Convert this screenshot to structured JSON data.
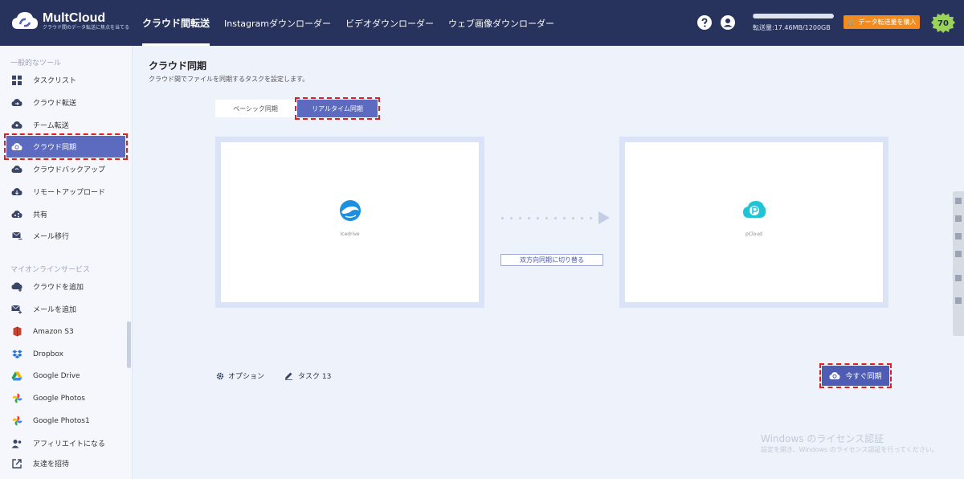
{
  "header": {
    "brand_name": "MultCloud",
    "brand_tagline": "クラウド間のデータ転送に焦点を当てる",
    "nav": [
      {
        "label": "クラウド間転送",
        "active": true
      },
      {
        "label": "Instagramダウンローダー",
        "active": false
      },
      {
        "label": "ビデオダウンローダー",
        "active": false
      },
      {
        "label": "ウェブ画像ダウンローダー",
        "active": false
      }
    ],
    "usage_text": "転送量:17.46MB/1200GB",
    "usage_fraction": 1.46e-05,
    "buy_label": "データ転送量を購入",
    "badge_value": "70",
    "accent": "#f28c1e",
    "bar_color": "#27335c"
  },
  "sidebar": {
    "section_general": "一般的なツール",
    "general_items": [
      {
        "label": "タスクリスト",
        "icon": "grid-icon"
      },
      {
        "label": "クラウド転送",
        "icon": "cloud-transfer-icon"
      },
      {
        "label": "チーム転送",
        "icon": "team-transfer-icon"
      },
      {
        "label": "クラウド同期",
        "icon": "cloud-sync-icon",
        "active": true
      },
      {
        "label": "クラウドバックアップ",
        "icon": "cloud-backup-icon"
      },
      {
        "label": "リモートアップロード",
        "icon": "remote-upload-icon"
      },
      {
        "label": "共有",
        "icon": "share-icon"
      },
      {
        "label": "メール移行",
        "icon": "mail-migration-icon"
      }
    ],
    "section_services": "マイオンラインサービス",
    "service_items": [
      {
        "label": "クラウドを追加",
        "icon": "add-cloud-icon"
      },
      {
        "label": "メールを追加",
        "icon": "add-mail-icon"
      },
      {
        "label": "Amazon S3",
        "icon": "amazon-s3-icon"
      },
      {
        "label": "Dropbox",
        "icon": "dropbox-icon"
      },
      {
        "label": "Google Drive",
        "icon": "google-drive-icon"
      },
      {
        "label": "Google Photos",
        "icon": "google-photos-icon"
      },
      {
        "label": "Google Photos1",
        "icon": "google-photos-icon"
      },
      {
        "label": "アフィリエイトになる",
        "icon": "affiliate-icon"
      },
      {
        "label": "友達を招待",
        "icon": "invite-icon"
      }
    ]
  },
  "main": {
    "title": "クラウド同期",
    "subtitle": "クラウド間でファイルを同期するタスクを設定します。",
    "tab_basic": "ベーシック同期",
    "tab_realtime": "リアルタイム同期",
    "source_label": "Icedrive",
    "target_label": "pCloud",
    "switch_label": "双方向同期に切り替る",
    "options_label": "オプション",
    "task_label": "タスク 13",
    "sync_now_label": "今すぐ同期",
    "accent": "#5c6bc0"
  },
  "watermark": {
    "title": "Windows のライセンス認証",
    "subtitle": "設定を開き、Windows のライセンス認証を行ってください。"
  }
}
